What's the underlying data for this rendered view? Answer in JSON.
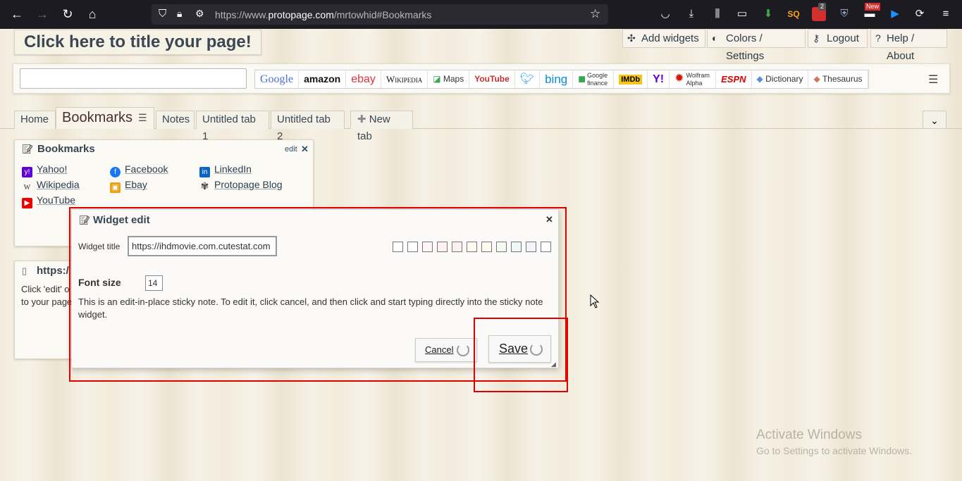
{
  "browser": {
    "url_prefix": "https://www.",
    "url_domain": "protopage.com",
    "url_path": "/mrtowhid#Bookmarks",
    "badge_count": "2",
    "new_badge": "New"
  },
  "page": {
    "title": "Click here to title your page!"
  },
  "top_menu": {
    "add_widgets": "Add widgets",
    "colors_settings": "Colors / Settings",
    "logout": "Logout",
    "help_about": "Help / About"
  },
  "search_engines": [
    "Google",
    "amazon",
    "ebay",
    "Wikipedia",
    "Maps",
    "YouTube",
    "",
    "bing",
    "Google finance",
    "IMDb",
    "Y!",
    "Wolfram Alpha",
    "ESPN",
    "Dictionary",
    "Thesaurus"
  ],
  "tabs": {
    "home": "Home",
    "bookmarks": "Bookmarks",
    "notes": "Notes",
    "untitled1": "Untitled tab 1",
    "untitled2": "Untitled tab 2",
    "new_tab": "New tab"
  },
  "bookmarks_widget": {
    "title": "Bookmarks",
    "edit": "edit",
    "links": {
      "yahoo": "Yahoo!",
      "facebook": "Facebook",
      "linkedin": "LinkedIn",
      "wikipedia": "Wikipedia",
      "ebay": "Ebay",
      "protopage_blog": "Protopage Blog",
      "youtube": "YouTube"
    }
  },
  "note_widget": {
    "title": "https:/",
    "body_line1": "Click 'edit' o",
    "body_line2": "to your page"
  },
  "dialog": {
    "title": "Widget edit",
    "widget_title_label": "Widget title",
    "widget_title_value": "https://ihdmovie.com.cutestat.com",
    "font_size_label": "Font size",
    "font_size_value": "14",
    "description": "This is an edit-in-place sticky note. To edit it, click cancel, and then click and start typing directly into the sticky note widget.",
    "cancel": "Cancel",
    "save": "Save"
  },
  "watermark": {
    "title": "Activate Windows",
    "subtitle": "Go to Settings to activate Windows."
  },
  "colors": {
    "annotation_red": "#e00000",
    "swatches": [
      "#ffffff",
      "#ffffff",
      "#fff4f8",
      "#fff0f4",
      "#fdf0f0",
      "#fffaf0",
      "#fbfbf0",
      "#f6fbf2",
      "#eef8f6",
      "#f2f6fc",
      "#ffffff"
    ]
  }
}
